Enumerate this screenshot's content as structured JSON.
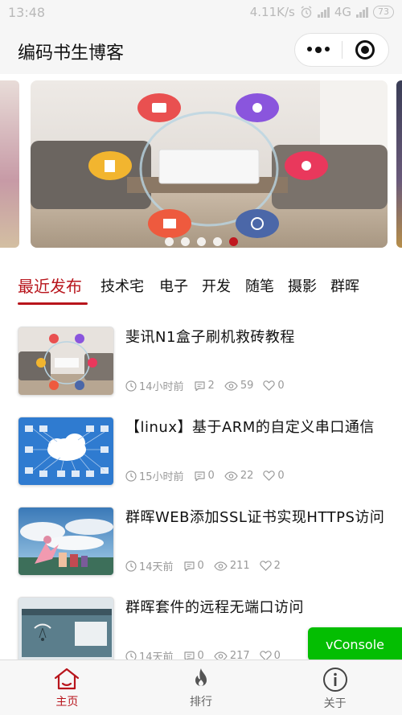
{
  "status_bar": {
    "time": "13:48",
    "speed": "4.11K/s",
    "network": "4G",
    "battery": "73"
  },
  "navbar": {
    "title": "编码书生博客",
    "more_icon": "more-dots-icon",
    "close_icon": "record-circle-icon"
  },
  "banner": {
    "slide_count": 5,
    "active_index": 4
  },
  "tabs": [
    {
      "label": "最近发布",
      "active": true
    },
    {
      "label": "技术宅"
    },
    {
      "label": "电子"
    },
    {
      "label": "开发"
    },
    {
      "label": "随笔"
    },
    {
      "label": "摄影"
    },
    {
      "label": "群晖"
    }
  ],
  "posts": [
    {
      "title": "斐讯N1盒子刷机救砖教程",
      "time": "14小时前",
      "comments": "2",
      "views": "59",
      "likes": "0"
    },
    {
      "title": "【linux】基于ARM的自定义串口通信",
      "time": "15小时前",
      "comments": "0",
      "views": "22",
      "likes": "0"
    },
    {
      "title": "群晖WEB添加SSL证书实现HTTPS访问",
      "time": "14天前",
      "comments": "0",
      "views": "211",
      "likes": "2"
    },
    {
      "title": "群晖套件的远程无端口访问",
      "time": "14天前",
      "comments": "0",
      "views": "217",
      "likes": "0"
    }
  ],
  "vconsole": {
    "label": "vConsole"
  },
  "tabbar": [
    {
      "label": "主页",
      "icon": "home-icon",
      "active": true
    },
    {
      "label": "排行",
      "icon": "flame-icon"
    },
    {
      "label": "关于",
      "icon": "info-icon"
    }
  ],
  "colors": {
    "accent": "#b8151c",
    "vconsole": "#04be02",
    "meta": "#999999"
  }
}
